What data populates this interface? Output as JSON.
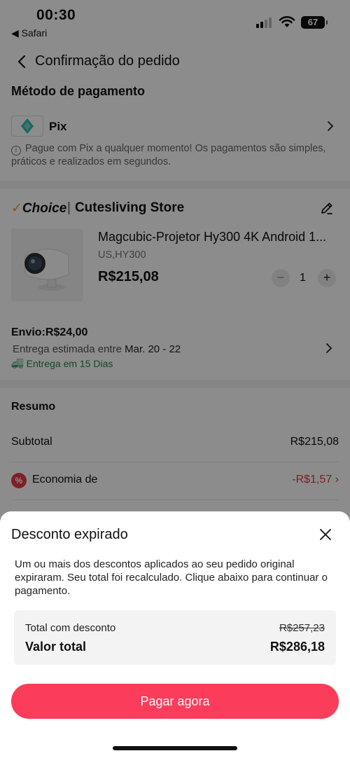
{
  "status_bar": {
    "time": "00:30",
    "back_app": "◀ Safari",
    "battery": "67"
  },
  "header": {
    "title": "Confirmação do pedido"
  },
  "payment": {
    "section_title": "Método de pagamento",
    "method": "Pix",
    "note": "Pague com Pix a qualquer momento! Os pagamentos são simples, práticos e realizados em segundos."
  },
  "store": {
    "choice_label": "Choice",
    "store_name": "Cutesliving Store",
    "product_title": "Magcubic-Projetor Hy300 4K Android 1...",
    "variant": "US,HY300",
    "price": "R$215,08",
    "quantity": "1",
    "shipping_label": "Envio:R$24,00",
    "estimate_prefix": "Entrega estimada entre",
    "estimate_dates": "Mar. 20 - 22",
    "delivery_days": "Entrega em 15 Dias"
  },
  "summary": {
    "section_title": "Resumo",
    "subtotal_label": "Subtotal",
    "subtotal_value": "R$215,08",
    "economy_label": "Economia de",
    "economy_value": "-R$1,57"
  },
  "sheet": {
    "title": "Desconto expirado",
    "message": "Um ou mais dos descontos aplicados ao seu pedido original expiraram. Seu total foi recalculado. Clique abaixo para continuar o pagamento.",
    "discount_label": "Total com desconto",
    "discount_value": "R$257,23",
    "total_label": "Valor total",
    "total_value": "R$286,18",
    "pay_button": "Pagar agora"
  },
  "colors": {
    "accent": "#fb3c5a",
    "pix": "#32bcad",
    "green": "#1a8a4a",
    "choice": "#e89b2a"
  }
}
